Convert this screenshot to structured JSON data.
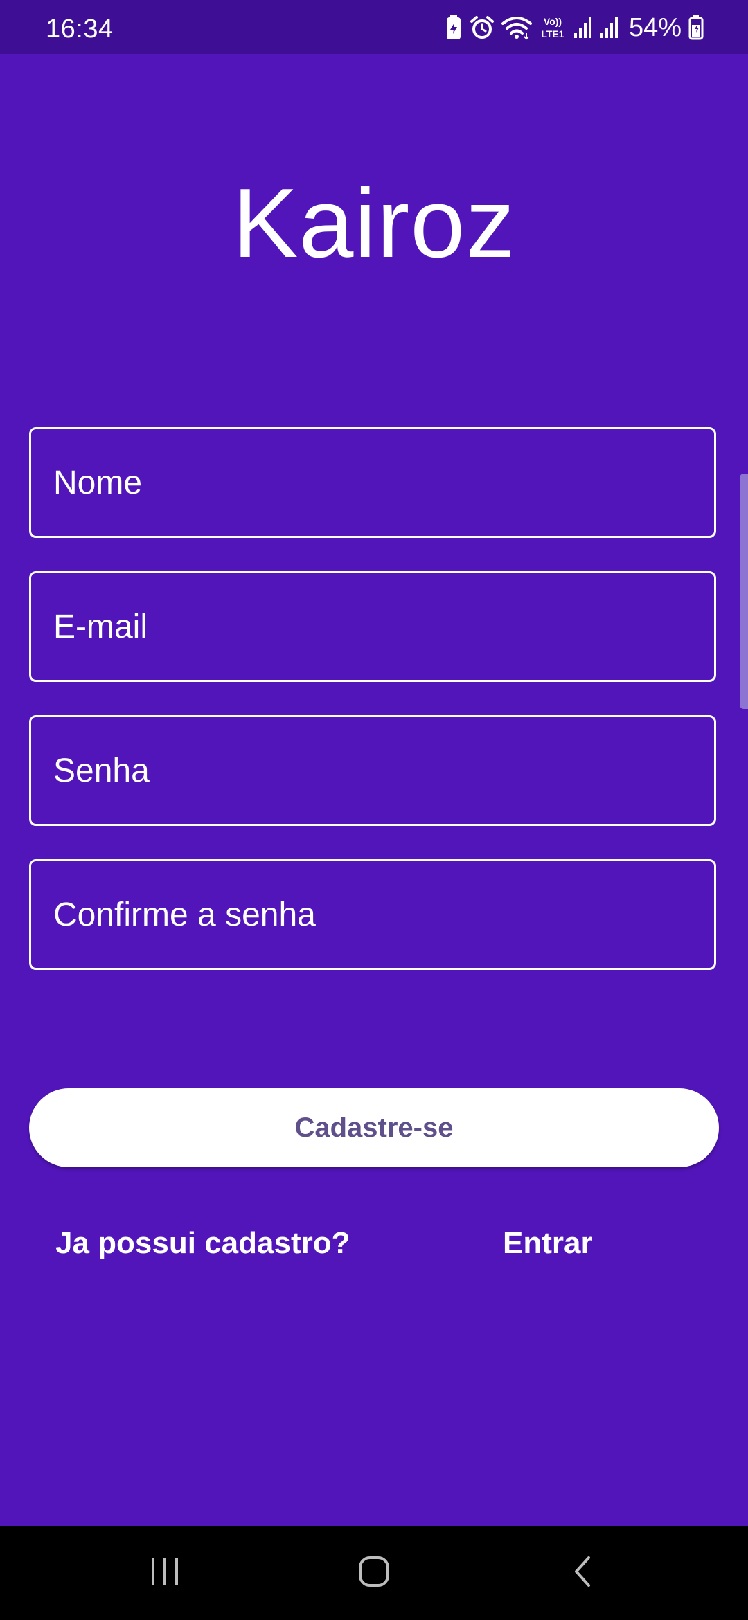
{
  "status_bar": {
    "time": "16:34",
    "battery_percent": "54%",
    "network_label": "Vo)) LTE1",
    "icons": [
      "battery-saver-icon",
      "alarm-icon",
      "wifi-icon",
      "volte-icon",
      "signal-icon",
      "signal-icon",
      "battery-charging-icon"
    ]
  },
  "app": {
    "title": "Kairoz"
  },
  "form": {
    "name_placeholder": "Nome",
    "email_placeholder": "E-mail",
    "password_placeholder": "Senha",
    "confirm_placeholder": "Confirme a senha",
    "submit_label": "Cadastre-se"
  },
  "footer": {
    "have_account_text": "Ja possui cadastro?",
    "login_label": "Entrar"
  },
  "nav": {
    "icons": [
      "recents-icon",
      "home-icon",
      "back-icon"
    ]
  },
  "colors": {
    "background": "#5115b9",
    "status_bar": "#3e0f94",
    "button_text": "#5f4f8a",
    "white": "#ffffff"
  }
}
